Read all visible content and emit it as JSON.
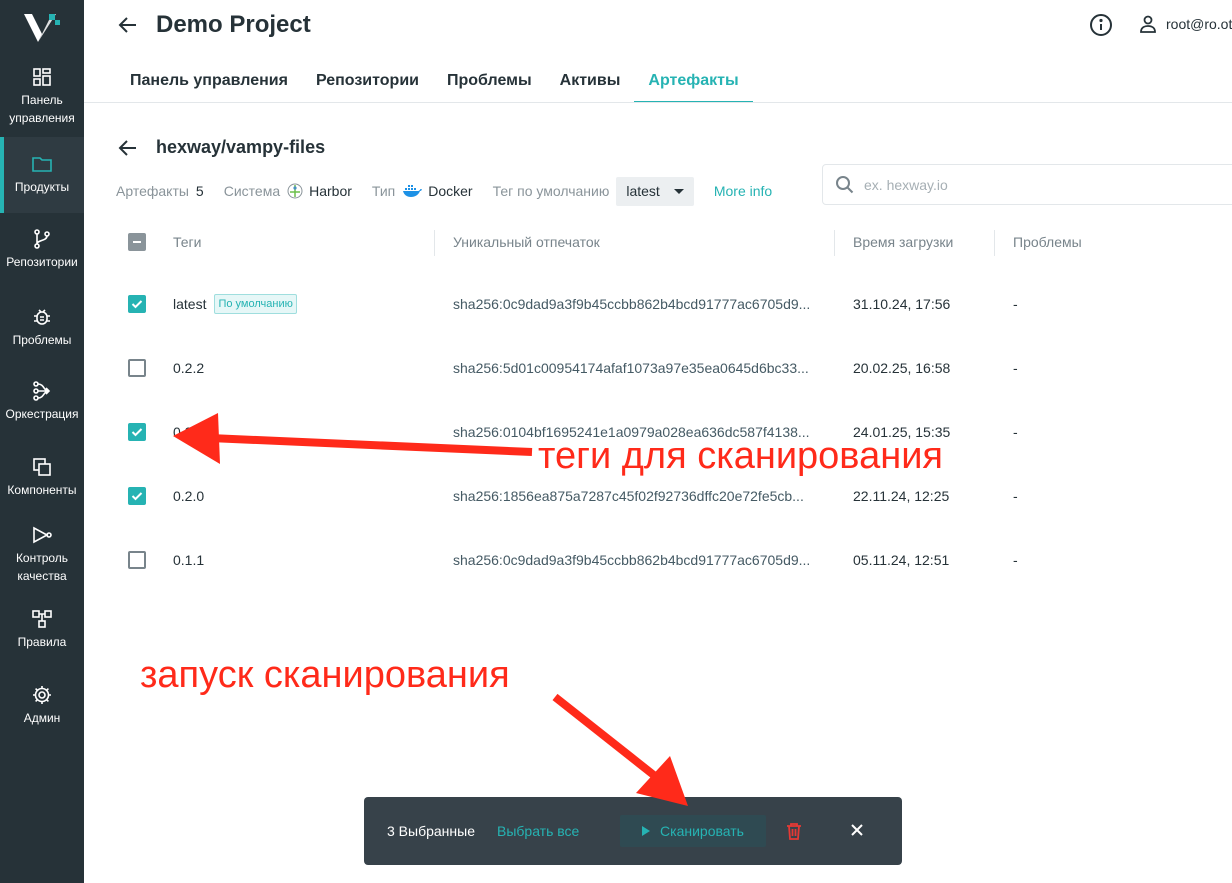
{
  "sidebar": {
    "items": [
      {
        "label": "Панель управления",
        "icon": "dashboard-icon"
      },
      {
        "label": "Продукты",
        "icon": "folder-icon",
        "active": true
      },
      {
        "label": "Репозитории",
        "icon": "branch-icon"
      },
      {
        "label": "Проблемы",
        "icon": "bug-icon"
      },
      {
        "label": "Оркестрация",
        "icon": "orchestration-icon"
      },
      {
        "label": "Компоненты",
        "icon": "components-icon"
      },
      {
        "label": "Контроль качества",
        "icon": "quality-icon"
      },
      {
        "label": "Правила",
        "icon": "rules-icon"
      },
      {
        "label": "Админ",
        "icon": "gear-icon"
      }
    ]
  },
  "header": {
    "title": "Demo Project",
    "user": "root@ro.ot",
    "tabs": [
      {
        "label": "Панель управления"
      },
      {
        "label": "Репозитории"
      },
      {
        "label": "Проблемы"
      },
      {
        "label": "Активы"
      },
      {
        "label": "Артефакты",
        "active": true
      }
    ]
  },
  "repo": {
    "title": "hexway/vampy-files",
    "artifacts_label": "Артефакты",
    "artifacts_count": "5",
    "system_label": "Система",
    "system_value": "Harbor",
    "type_label": "Тип",
    "type_value": "Docker",
    "default_tag_label": "Тег по умолчанию",
    "default_tag_value": "latest",
    "more_info": "More info"
  },
  "search": {
    "placeholder": "ex. hexway.io"
  },
  "table": {
    "headers": [
      "Теги",
      "Уникальный отпечаток",
      "Время загрузки",
      "Проблемы"
    ],
    "default_badge": "По умолчанию",
    "rows": [
      {
        "tag": "latest",
        "digest": "sha256:0c9dad9a3f9b45ccbb862b4bcd91777ac6705d9...",
        "time": "31.10.24, 17:56",
        "issues": "-",
        "checked": true,
        "default": true
      },
      {
        "tag": "0.2.2",
        "digest": "sha256:5d01c00954174afaf1073a97e35ea0645d6bc33...",
        "time": "20.02.25, 16:58",
        "issues": "-",
        "checked": false
      },
      {
        "tag": "0.2.1",
        "digest": "sha256:0104bf1695241e1a0979a028ea636dc587f4138...",
        "time": "24.01.25, 15:35",
        "issues": "-",
        "checked": true
      },
      {
        "tag": "0.2.0",
        "digest": "sha256:1856ea875a7287c45f02f92736dffc20e72fe5cb...",
        "time": "22.11.24, 12:25",
        "issues": "-",
        "checked": true
      },
      {
        "tag": "0.1.1",
        "digest": "sha256:0c9dad9a3f9b45ccbb862b4bcd91777ac6705d9...",
        "time": "05.11.24, 12:51",
        "issues": "-",
        "checked": false
      }
    ]
  },
  "actionbar": {
    "selected": "3 Выбранные",
    "select_all": "Выбрать все",
    "scan": "Сканировать"
  },
  "annotations": {
    "tags_for_scan": "теги для сканирования",
    "start_scan": "запуск сканирования"
  },
  "colors": {
    "accent": "#26b3b3",
    "sidebar": "#263238",
    "annotation": "#ff2a1a",
    "danger": "#e53935"
  }
}
